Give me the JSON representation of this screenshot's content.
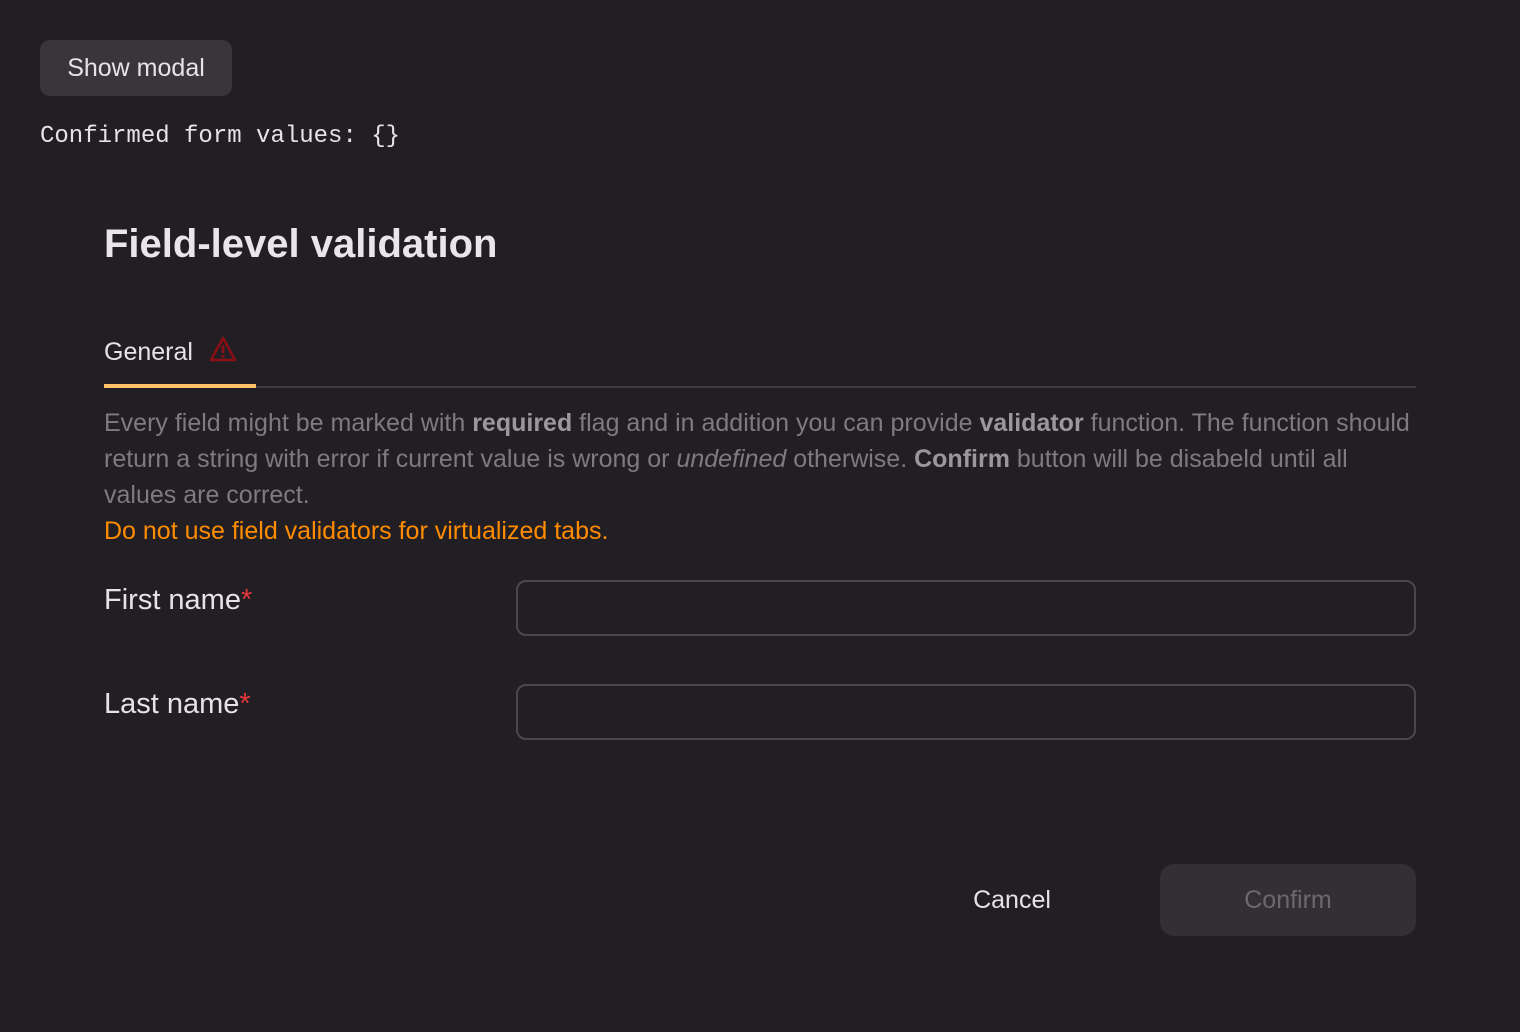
{
  "show_modal_label": "Show modal",
  "confirmed_text": "Confirmed form values: {}",
  "dialog": {
    "title": "Field-level validation",
    "tabs": [
      {
        "label": "General",
        "icon": "warning-icon",
        "error_color": "#8b0f14"
      }
    ],
    "description": {
      "p1": "Every field might be marked with ",
      "b1": "required",
      "p2": " flag and in addition you can provide ",
      "b2": "validator",
      "p3": " function. The function should return a string with error if current value is wrong or ",
      "i1": "undefined",
      "p4": " otherwise. ",
      "b3": "Confirm",
      "p5": " button will be disabeld until all values are correct."
    },
    "warning": "Do not use field validators for virtualized tabs.",
    "fields": [
      {
        "label": "First name",
        "required_mark": "*",
        "value": ""
      },
      {
        "label": "Last name",
        "required_mark": "*",
        "value": ""
      }
    ],
    "cancel_label": "Cancel",
    "confirm_label": "Confirm"
  },
  "colors": {
    "background": "#221f24",
    "accent": "#ffc266",
    "warning": "#ff8c00",
    "required": "#e5383b"
  }
}
